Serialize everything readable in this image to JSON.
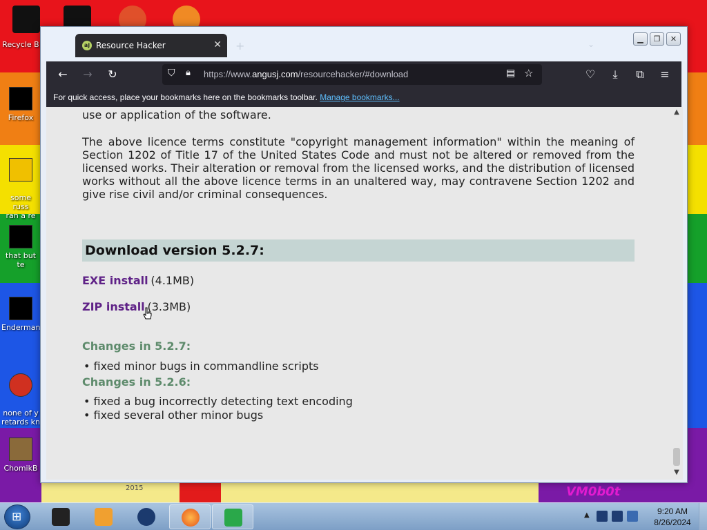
{
  "desktop": {
    "icons": [
      {
        "label": "Recycle B"
      },
      {
        "label": "Firefox"
      },
      {
        "label": "some russ\nran a re"
      },
      {
        "label": "that but te"
      },
      {
        "label": "Enderman"
      },
      {
        "label": "none of y\nretards kn"
      },
      {
        "label": "ChomikB"
      }
    ],
    "cartoon_year": "2015",
    "cartoon_signature": "VM0b0t"
  },
  "browser": {
    "tab_title": "Resource Hacker",
    "tab_favicon_text": "aj",
    "url_prefix": "https://www.",
    "url_domain": "angusj.com",
    "url_path": "/resourcehacker/#download",
    "bookmarks_prompt": "For quick access, place your bookmarks here on the bookmarks toolbar.",
    "bookmarks_link": "Manage bookmarks..."
  },
  "page": {
    "licence_tail": "use or application of the software.",
    "licence_para": "The above licence terms constitute \"copyright management information\" within the meaning of Section 1202 of Title 17 of the United States Code and must not be altered or removed from the licensed works. Their alteration or removal from the licensed works, and the distribution of licensed works without all the above licence terms in an unaltered way, may contravene Section 1202 and give rise civil and/or criminal consequences.",
    "download_heading": "Download version 5.2.7:",
    "exe_link": "EXE install",
    "exe_size": "(4.1MB)",
    "zip_link": "ZIP install",
    "zip_size": "(3.3MB)",
    "changes_527": "Changes in 5.2.7:",
    "changes_527_items": [
      "• fixed minor bugs in commandline scripts"
    ],
    "changes_526": "Changes in 5.2.6:",
    "changes_526_items": [
      "• fixed a bug incorrectly detecting text encoding",
      "• fixed several other minor bugs"
    ]
  },
  "taskbar": {
    "time": "9:20 AM",
    "date": "8/26/2024"
  }
}
